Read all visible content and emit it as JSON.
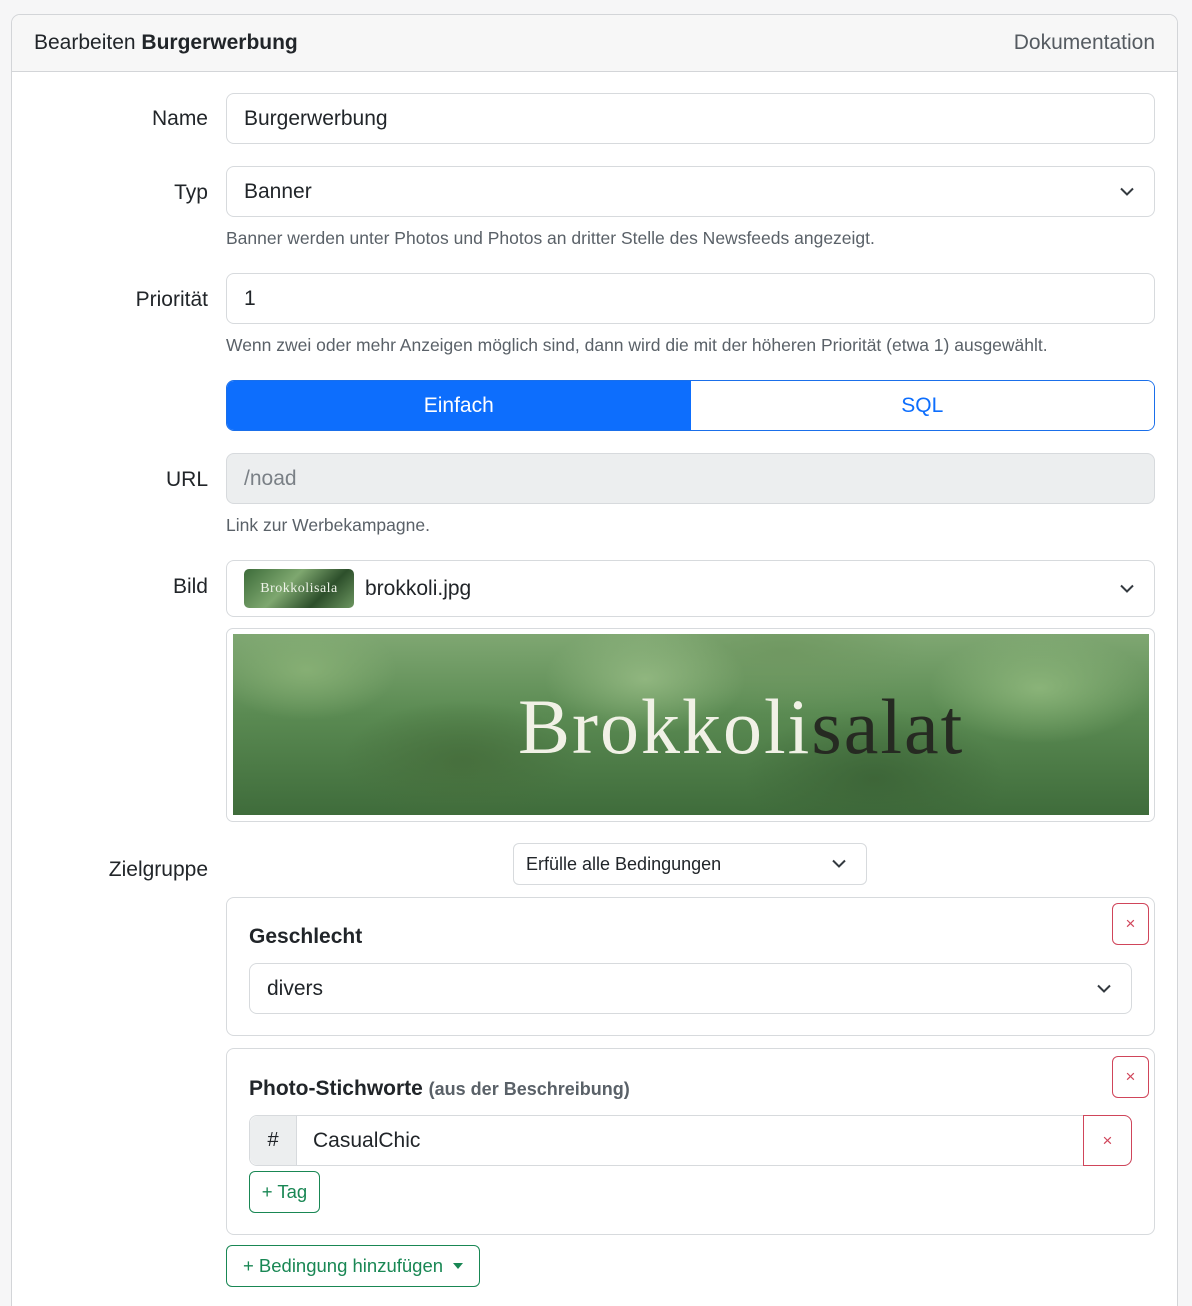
{
  "header": {
    "title_prefix": "Bearbeiten",
    "title_name": "Burgerwerbung",
    "docs_link": "Dokumentation"
  },
  "form": {
    "name": {
      "label": "Name",
      "value": "Burgerwerbung"
    },
    "type": {
      "label": "Typ",
      "value": "Banner",
      "hint": "Banner werden unter Photos und Photos an dritter Stelle des Newsfeeds angezeigt."
    },
    "priority": {
      "label": "Priorität",
      "value": "1",
      "hint": "Wenn zwei oder mehr Anzeigen möglich sind, dann wird die mit der höheren Priorität (etwa 1) ausgewählt."
    },
    "mode_toggle": {
      "simple": "Einfach",
      "sql": "SQL",
      "active": "Einfach"
    },
    "url": {
      "label": "URL",
      "placeholder": "/noad",
      "hint": "Link zur Werbekampagne."
    },
    "image": {
      "label": "Bild",
      "filename": "brokkoli.jpg",
      "thumb_text": "Brokkolisala",
      "preview_text_light": "Brokkoli",
      "preview_text_dark": "salat"
    },
    "audience": {
      "label": "Zielgruppe",
      "match_mode": "Erfülle alle Bedingungen",
      "conditions": [
        {
          "title": "Geschlecht",
          "value": "divers"
        },
        {
          "title": "Photo-Stichworte",
          "subtitle": "(aus der Beschreibung)",
          "tag_prefix": "#",
          "tags": [
            "CasualChic"
          ],
          "add_tag_label": "+ Tag"
        }
      ],
      "add_condition_label": "+ Bedingung hinzufügen"
    }
  },
  "icons": {
    "remove": "×",
    "chevron": "chevron-down-icon"
  },
  "colors": {
    "primary": "#0d6efd",
    "success": "#198754",
    "danger": "#d0455a"
  }
}
